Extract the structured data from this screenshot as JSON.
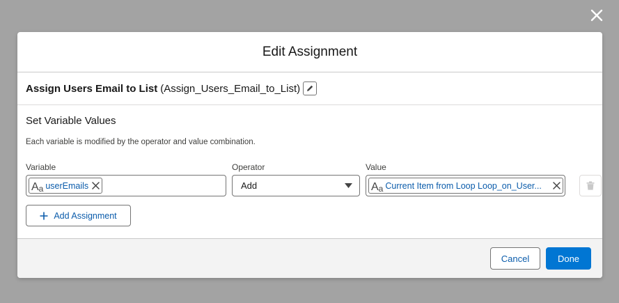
{
  "modal": {
    "title": "Edit Assignment"
  },
  "element": {
    "label": "Assign Users Email to List",
    "api_name": "(Assign_Users_Email_to_List)"
  },
  "section": {
    "title": "Set Variable Values",
    "help_text": "Each variable is modified by the operator and value combination."
  },
  "columns": {
    "variable": "Variable",
    "operator": "Operator",
    "value": "Value"
  },
  "row": {
    "variable_icon_big": "A",
    "variable_icon_small": "a",
    "variable": "userEmails",
    "operator": "Add",
    "value_icon_big": "A",
    "value_icon_small": "a",
    "value": "Current Item from Loop Loop_on_User..."
  },
  "actions": {
    "add_assignment": "Add Assignment",
    "cancel": "Cancel",
    "done": "Done"
  },
  "colors": {
    "brand": "#0176d3",
    "link": "#0b5cab",
    "overlay": "#a3a3a3"
  }
}
